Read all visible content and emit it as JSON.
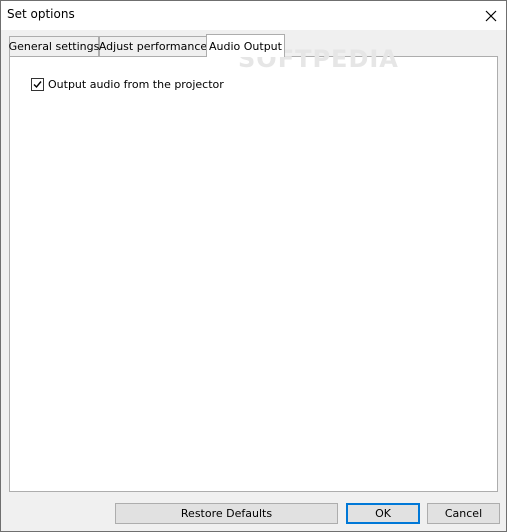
{
  "window": {
    "title": "Set options"
  },
  "tabs": [
    {
      "label": "General settings",
      "active": false
    },
    {
      "label": "Adjust performance",
      "active": false
    },
    {
      "label": "Audio Output",
      "active": true
    }
  ],
  "audio_output": {
    "output_audio_label": "Output audio from the projector",
    "output_audio_checked": true
  },
  "watermark": "SOFTPEDIA",
  "buttons": {
    "restore_defaults": "Restore Defaults",
    "ok": "OK",
    "cancel": "Cancel"
  },
  "colors": {
    "accent": "#0078d7",
    "panel_bg": "#ffffff",
    "window_bg": "#f0f0f0"
  },
  "icons": {
    "close": "close-icon",
    "check": "check-icon"
  }
}
